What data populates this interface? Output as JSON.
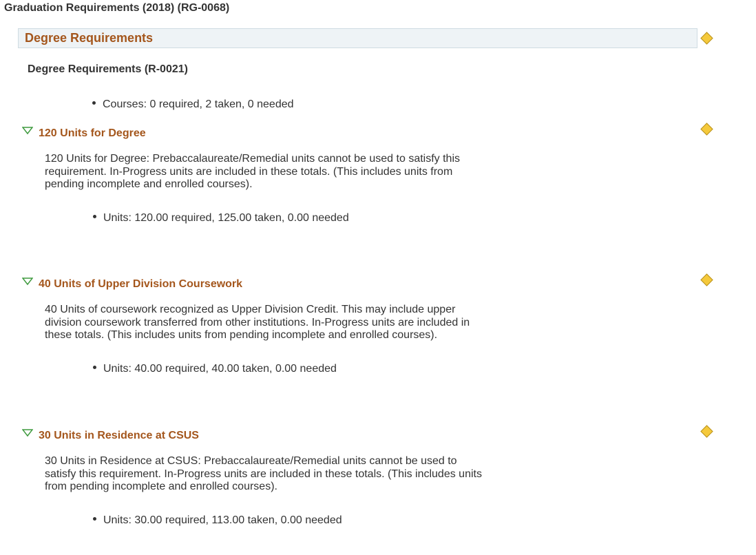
{
  "page_title": "Graduation Requirements (2018) (RG-0068)",
  "group": {
    "title": "Degree Requirements",
    "requirement_title": "Degree Requirements (R-0021)",
    "summary": "Courses: 0 required, 2 taken, 0 needed"
  },
  "sections": [
    {
      "title": "120 Units for Degree",
      "description": "120 Units for Degree: Prebaccalaureate/Remedial units cannot be used to satisfy this requirement. In-Progress units are included in these totals. (This includes units from pending incomplete and enrolled courses).",
      "summary": "Units: 120.00 required, 125.00 taken, 0.00 needed"
    },
    {
      "title": "40 Units of Upper Division Coursework",
      "description": "40 Units of coursework recognized as Upper Division Credit. This may include upper division coursework transferred from other institutions. In-Progress units are included in these totals. (This includes units from pending incomplete and enrolled courses).",
      "summary": "Units: 40.00 required, 40.00 taken, 0.00 needed"
    },
    {
      "title": "30 Units in Residence at CSUS",
      "description": "30 Units in Residence at CSUS: Prebaccalaureate/Remedial units cannot be used to satisfy this requirement. In-Progress units are included in these totals. (This includes units from pending incomplete and enrolled courses).",
      "summary": "Units: 30.00 required, 113.00 taken, 0.00 needed"
    }
  ],
  "icons": {
    "status": "in-progress-diamond-icon",
    "collapse": "triangle-down-icon"
  },
  "colors": {
    "section_title": "#a4561c",
    "status_diamond": "#f5c93b",
    "collapse_triangle": "#3e9a3e",
    "header_bg": "#eef3f6"
  }
}
